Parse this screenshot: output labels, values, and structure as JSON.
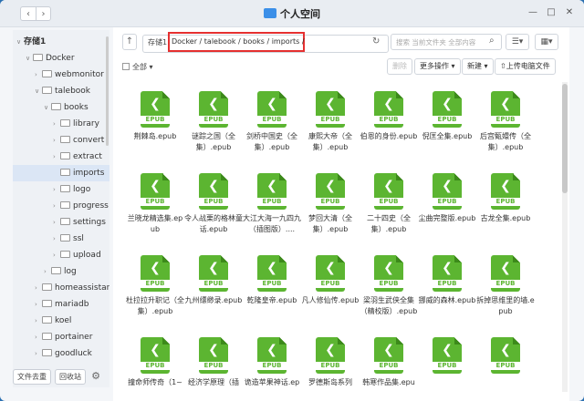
{
  "window": {
    "title": "个人空间"
  },
  "sidebar": {
    "items": [
      {
        "label": "存储1",
        "level": 0,
        "arrow": "∨",
        "bold": true
      },
      {
        "label": "Docker",
        "level": 1,
        "arrow": "∨"
      },
      {
        "label": "webmonitor",
        "level": 2,
        "arrow": "›"
      },
      {
        "label": "talebook",
        "level": 2,
        "arrow": "∨"
      },
      {
        "label": "books",
        "level": 3,
        "arrow": "∨"
      },
      {
        "label": "library",
        "level": 4,
        "arrow": "›"
      },
      {
        "label": "convert",
        "level": 4,
        "arrow": "›"
      },
      {
        "label": "extract",
        "level": 4,
        "arrow": "›"
      },
      {
        "label": "imports",
        "level": 4,
        "arrow": "",
        "selected": true
      },
      {
        "label": "logo",
        "level": 4,
        "arrow": "›"
      },
      {
        "label": "progress",
        "level": 4,
        "arrow": "›"
      },
      {
        "label": "settings",
        "level": 4,
        "arrow": "›"
      },
      {
        "label": "ssl",
        "level": 4,
        "arrow": "›"
      },
      {
        "label": "upload",
        "level": 4,
        "arrow": "›"
      },
      {
        "label": "log",
        "level": 3,
        "arrow": "›"
      },
      {
        "label": "homeassistar",
        "level": 2,
        "arrow": "›"
      },
      {
        "label": "mariadb",
        "level": 2,
        "arrow": "›"
      },
      {
        "label": "koel",
        "level": 2,
        "arrow": "›"
      },
      {
        "label": "portainer",
        "level": 2,
        "arrow": "›"
      },
      {
        "label": "goodluck",
        "level": 2,
        "arrow": "›"
      }
    ],
    "footer": {
      "trash_label": "文件去重",
      "recycle_label": "回收站"
    }
  },
  "pathbar": {
    "root": "存储1",
    "path": "Docker / talebook / books / imports /",
    "search_placeholder": "搜索 当前文件夹 全部内容"
  },
  "toolbar": {
    "select_all": "全部",
    "delete": "删除",
    "more": "更多操作",
    "new": "新建",
    "upload": "上传电脑文件"
  },
  "files": [
    {
      "name": "荆棘岛.epub"
    },
    {
      "name": "谜踪之国（全集）.epub"
    },
    {
      "name": "剑桥中国史（全集）.epub"
    },
    {
      "name": "康熙大帝（全集）.epub"
    },
    {
      "name": "伯恩的身份.epub"
    },
    {
      "name": "倪匡全集.epub"
    },
    {
      "name": "后宫甄嬛传（全集）.epub"
    },
    {
      "name": "兰晓龙精选集.epub"
    },
    {
      "name": "令人战栗的格林童话.epub"
    },
    {
      "name": "大江大海一九四九（插图版）...."
    },
    {
      "name": "梦回大清（全集）.epub"
    },
    {
      "name": "二十四史（全集）.epub"
    },
    {
      "name": "尘曲完整版.epub"
    },
    {
      "name": "古龙全集.epub"
    },
    {
      "name": "杜拉拉升职记（全集）.epub"
    },
    {
      "name": "九州缥缈录.epub"
    },
    {
      "name": "乾隆皇帝.epub"
    },
    {
      "name": "凡人修仙传.epub"
    },
    {
      "name": "梁羽生武侠全集（精校版）.epub"
    },
    {
      "name": "挪威的森林.epub"
    },
    {
      "name": "拆掉思维里的墙.epub"
    },
    {
      "name": "撞命师传奇（1~"
    },
    {
      "name": "经济学原理（插"
    },
    {
      "name": "诡造苹果神话.ep"
    },
    {
      "name": "罗德斯岛系列"
    },
    {
      "name": "韩寒作品集.epu"
    },
    {
      "name": ""
    },
    {
      "name": ""
    }
  ],
  "epub_badge": "EPUB"
}
